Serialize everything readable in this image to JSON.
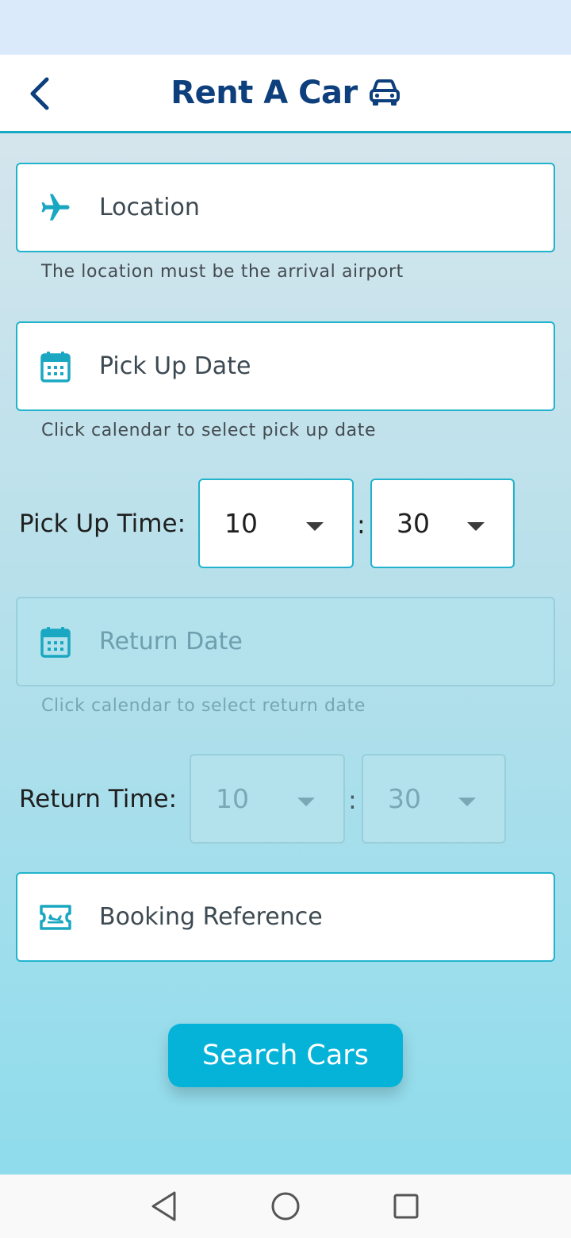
{
  "header": {
    "title": "Rent A Car",
    "back_icon": "chevron-left-icon",
    "title_icon": "car-icon"
  },
  "form": {
    "location": {
      "label": "Location",
      "icon": "airplane-icon",
      "helper": "The location must be the arrival airport"
    },
    "pickup_date": {
      "label": "Pick Up Date",
      "icon": "calendar-icon",
      "helper": "Click calendar to select pick up date"
    },
    "pickup_time": {
      "label": "Pick Up Time:",
      "hour": "10",
      "minute": "30",
      "separator": ":"
    },
    "return_date": {
      "label": "Return Date",
      "icon": "calendar-icon",
      "helper": "Click calendar to select return date",
      "disabled": true
    },
    "return_time": {
      "label": "Return Time:",
      "hour": "10",
      "minute": "30",
      "separator": ":",
      "disabled": true
    },
    "booking_reference": {
      "label": "Booking Reference",
      "icon": "ticket-flight-icon"
    },
    "search_label": "Search Cars"
  },
  "colors": {
    "title": "#0c3f7c",
    "accent": "#21b3cc",
    "button": "#05b3d9",
    "status_bar": "#dbeafb"
  },
  "nav": {
    "back_icon": "triangle-back-icon",
    "home_icon": "circle-home-icon",
    "recents_icon": "square-recents-icon"
  }
}
